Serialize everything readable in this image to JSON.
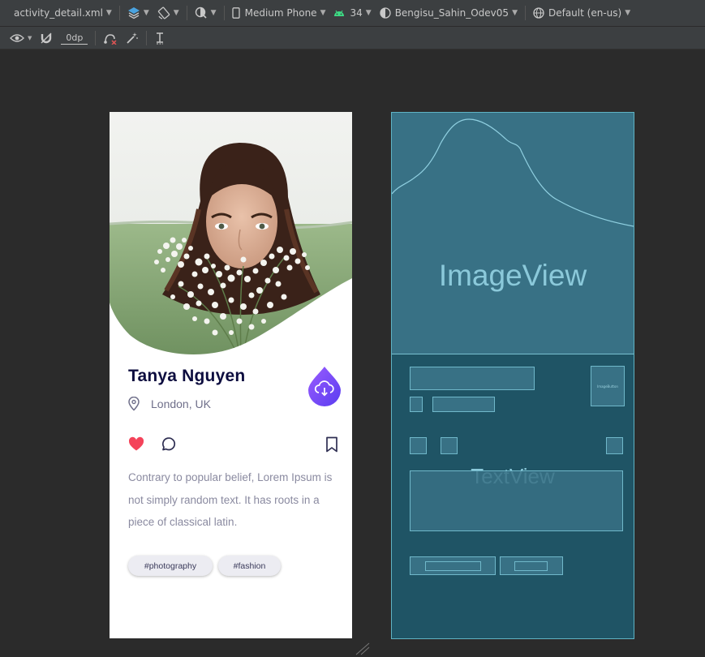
{
  "toolbar": {
    "file": "activity_detail.xml",
    "device": "Medium Phone",
    "api": "34",
    "theme": "Bengisu_Sahin_Odev05",
    "locale": "Default (en-us)",
    "margin": "0dp"
  },
  "profile": {
    "name": "Tanya Nguyen",
    "location": "London, UK",
    "description": "Contrary to popular belief, Lorem Ipsum is not simply random text. It has roots in a piece of classical latin.",
    "tags": [
      "#photography",
      "#fashion"
    ]
  },
  "blueprint": {
    "image_label": "ImageView",
    "text_label": "TextView",
    "button_label": "ImageButton"
  },
  "colors": {
    "accent": "#7b4dff",
    "heart": "#f4435a",
    "name": "#0d0d3f",
    "blueprint_bg": "#1f5465"
  },
  "icons": [
    "eye-icon",
    "magnet-icon",
    "link-icon",
    "magic-wand-icon",
    "baseline-icon",
    "layers-icon",
    "rotate-icon",
    "night-mode-icon",
    "phone-icon",
    "android-icon",
    "theme-icon",
    "globe-icon",
    "location-pin-icon",
    "download-cloud-icon",
    "heart-icon",
    "comment-icon",
    "bookmark-icon"
  ]
}
